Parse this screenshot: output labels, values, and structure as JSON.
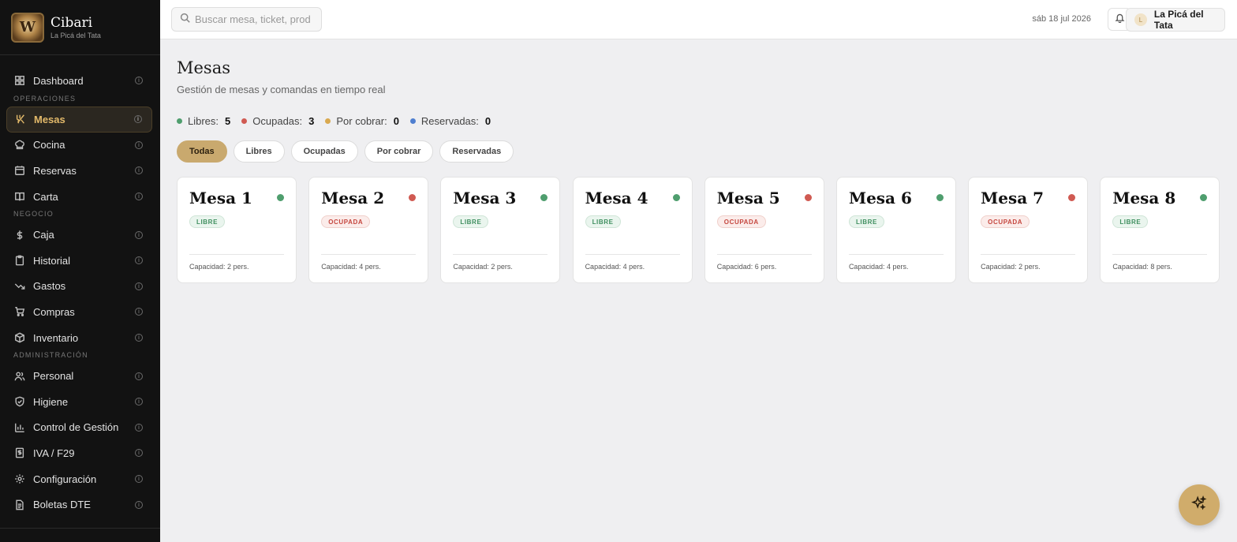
{
  "brand": {
    "name": "Cibari",
    "subtitle": "La Picá del Tata",
    "logo_letter": "W"
  },
  "sidebar": {
    "dashboard": {
      "label": "Dashboard",
      "icon": "grid-icon"
    },
    "sections": [
      {
        "title": "OPERACIONES",
        "items": [
          {
            "label": "Mesas",
            "icon": "utensils-icon",
            "active": true
          },
          {
            "label": "Cocina",
            "icon": "chef-hat-icon"
          },
          {
            "label": "Reservas",
            "icon": "calendar-icon"
          },
          {
            "label": "Carta",
            "icon": "book-icon"
          }
        ]
      },
      {
        "title": "NEGOCIO",
        "items": [
          {
            "label": "Caja",
            "icon": "dollar-icon"
          },
          {
            "label": "Historial",
            "icon": "clipboard-icon"
          },
          {
            "label": "Gastos",
            "icon": "trend-down-icon"
          },
          {
            "label": "Compras",
            "icon": "cart-icon"
          },
          {
            "label": "Inventario",
            "icon": "box-icon"
          }
        ]
      },
      {
        "title": "ADMINISTRACIÓN",
        "items": [
          {
            "label": "Personal",
            "icon": "users-icon"
          },
          {
            "label": "Higiene",
            "icon": "shield-icon"
          },
          {
            "label": "Control de Gestión",
            "icon": "bar-chart-icon"
          },
          {
            "label": "IVA / F29",
            "icon": "receipt-icon"
          },
          {
            "label": "Configuración",
            "icon": "gear-icon"
          },
          {
            "label": "Boletas DTE",
            "icon": "document-icon"
          }
        ]
      }
    ]
  },
  "topbar": {
    "search_placeholder": "Buscar mesa, ticket, prod",
    "date": "sáb 18 jul 2026",
    "user_initial": "L",
    "user_name": "La Picá del Tata"
  },
  "page": {
    "title": "Mesas",
    "subtitle": "Gestión de mesas y comandas en tiempo real"
  },
  "stats": [
    {
      "label": "Libres:",
      "value": "5",
      "color": "#4f9e6e"
    },
    {
      "label": "Ocupadas:",
      "value": "3",
      "color": "#d05a52"
    },
    {
      "label": "Por cobrar:",
      "value": "0",
      "color": "#d9a94f"
    },
    {
      "label": "Reservadas:",
      "value": "0",
      "color": "#4f7fd0"
    }
  ],
  "filters": [
    {
      "label": "Todas",
      "active": true
    },
    {
      "label": "Libres"
    },
    {
      "label": "Ocupadas"
    },
    {
      "label": "Por cobrar"
    },
    {
      "label": "Reservadas"
    }
  ],
  "tables": [
    {
      "name": "Mesa 1",
      "status": "LIBRE",
      "kind": "libre",
      "capacity": "Capacidad: 2 pers."
    },
    {
      "name": "Mesa 2",
      "status": "OCUPADA",
      "kind": "ocupada",
      "capacity": "Capacidad: 4 pers."
    },
    {
      "name": "Mesa 3",
      "status": "LIBRE",
      "kind": "libre",
      "capacity": "Capacidad: 2 pers."
    },
    {
      "name": "Mesa 4",
      "status": "LIBRE",
      "kind": "libre",
      "capacity": "Capacidad: 4 pers."
    },
    {
      "name": "Mesa 5",
      "status": "OCUPADA",
      "kind": "ocupada",
      "capacity": "Capacidad: 6 pers."
    },
    {
      "name": "Mesa 6",
      "status": "LIBRE",
      "kind": "libre",
      "capacity": "Capacidad: 4 pers."
    },
    {
      "name": "Mesa 7",
      "status": "OCUPADA",
      "kind": "ocupada",
      "capacity": "Capacidad: 2 pers."
    },
    {
      "name": "Mesa 8",
      "status": "LIBRE",
      "kind": "libre",
      "capacity": "Capacidad: 8 pers."
    }
  ],
  "colors": {
    "libre": "#4f9e6e",
    "ocupada": "#d05a52",
    "accent": "#c9a96e"
  }
}
